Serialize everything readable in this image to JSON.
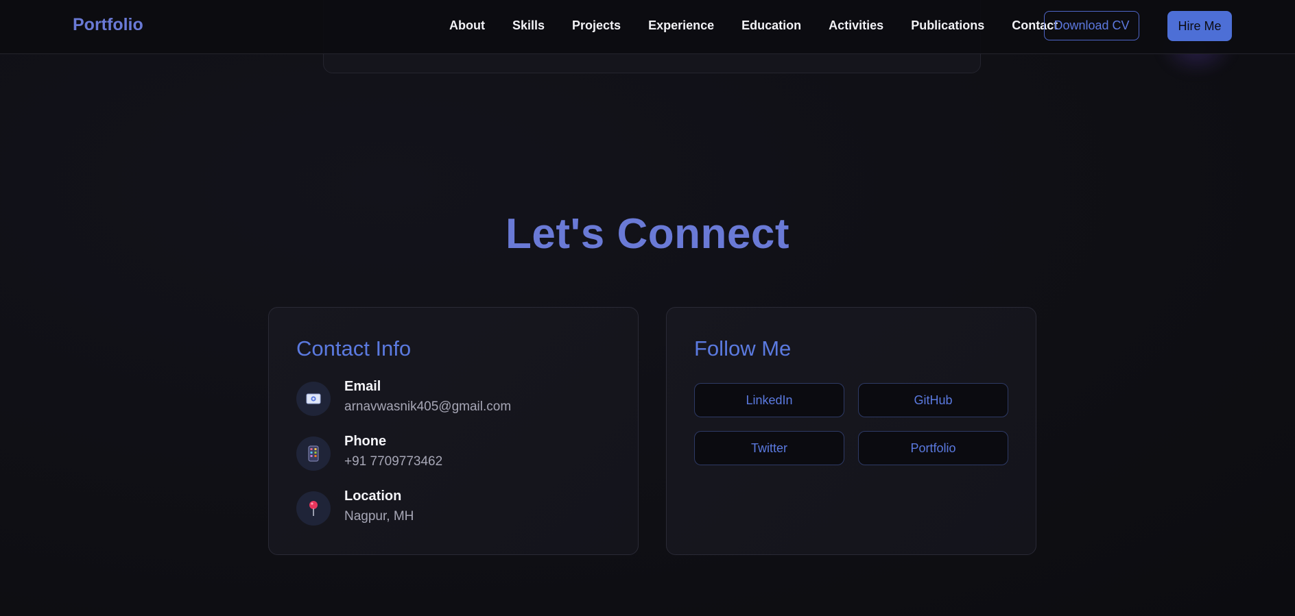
{
  "navbar": {
    "brand": "Portfolio",
    "links": [
      "About",
      "Skills",
      "Projects",
      "Experience",
      "Education",
      "Activities",
      "Publications",
      "Contact"
    ],
    "download_cv": "Download CV",
    "hire_me": "Hire Me"
  },
  "section": {
    "title": "Let's Connect"
  },
  "contact": {
    "title": "Contact Info",
    "items": [
      {
        "icon": "email-icon",
        "label": "Email",
        "value": "arnavwasnik405@gmail.com"
      },
      {
        "icon": "phone-icon",
        "label": "Phone",
        "value": "+91 7709773462"
      },
      {
        "icon": "location-pin-icon",
        "label": "Location",
        "value": "Nagpur, MH"
      }
    ]
  },
  "follow": {
    "title": "Follow Me",
    "links": [
      "LinkedIn",
      "GitHub",
      "Twitter",
      "Portfolio"
    ]
  },
  "colors": {
    "accent": "#6a7ad6",
    "accent_button": "#4d6fd6",
    "background": "#0f0f14",
    "card": "#16161d"
  }
}
